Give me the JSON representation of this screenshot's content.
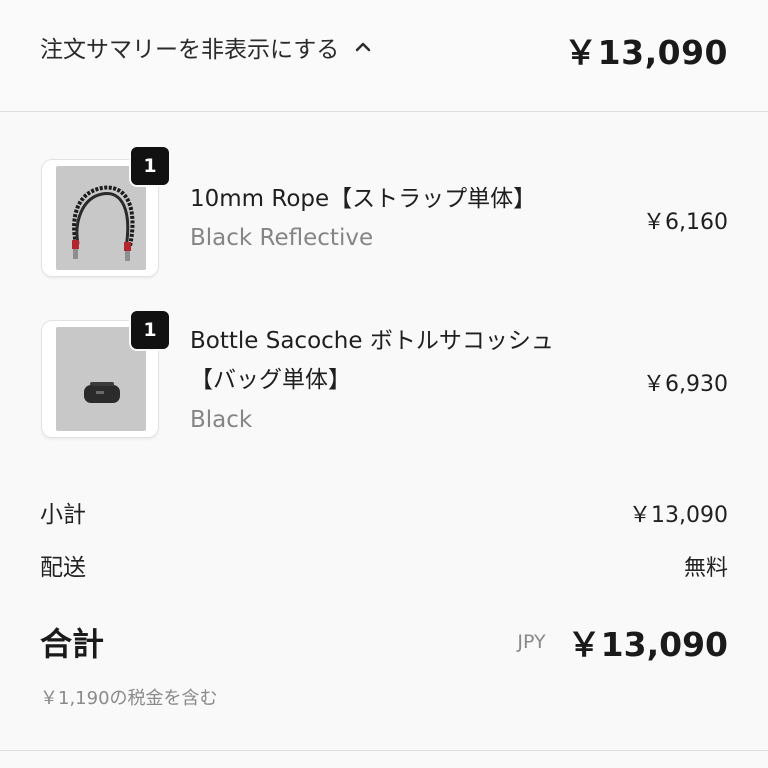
{
  "summary": {
    "toggle_label": "注文サマリーを非表示にする",
    "toggle_icon": "chevron-up-icon",
    "total": "￥13,090"
  },
  "items": [
    {
      "qty": "1",
      "name": "10mm Rope【ストラップ単体】",
      "variant": "Black Reflective",
      "price": "￥6,160",
      "image": "rope-strap-product-image"
    },
    {
      "qty": "1",
      "name_line1": "Bottle Sacoche ボトルサコッシュ",
      "name_line2": "【バッグ単体】",
      "variant": "Black",
      "price": "￥6,930",
      "image": "bottle-sacoche-product-image"
    }
  ],
  "totals": {
    "subtotal_label": "小計",
    "subtotal_value": "￥13,090",
    "shipping_label": "配送",
    "shipping_value": "無料",
    "total_label": "合計",
    "currency": "JPY",
    "total_value": "￥13,090",
    "tax_note": "￥1,190の税金を含む"
  },
  "colors": {
    "background": "#f9f9f9",
    "text": "#1a1a1a",
    "muted": "#858585",
    "badge": "#111111"
  }
}
